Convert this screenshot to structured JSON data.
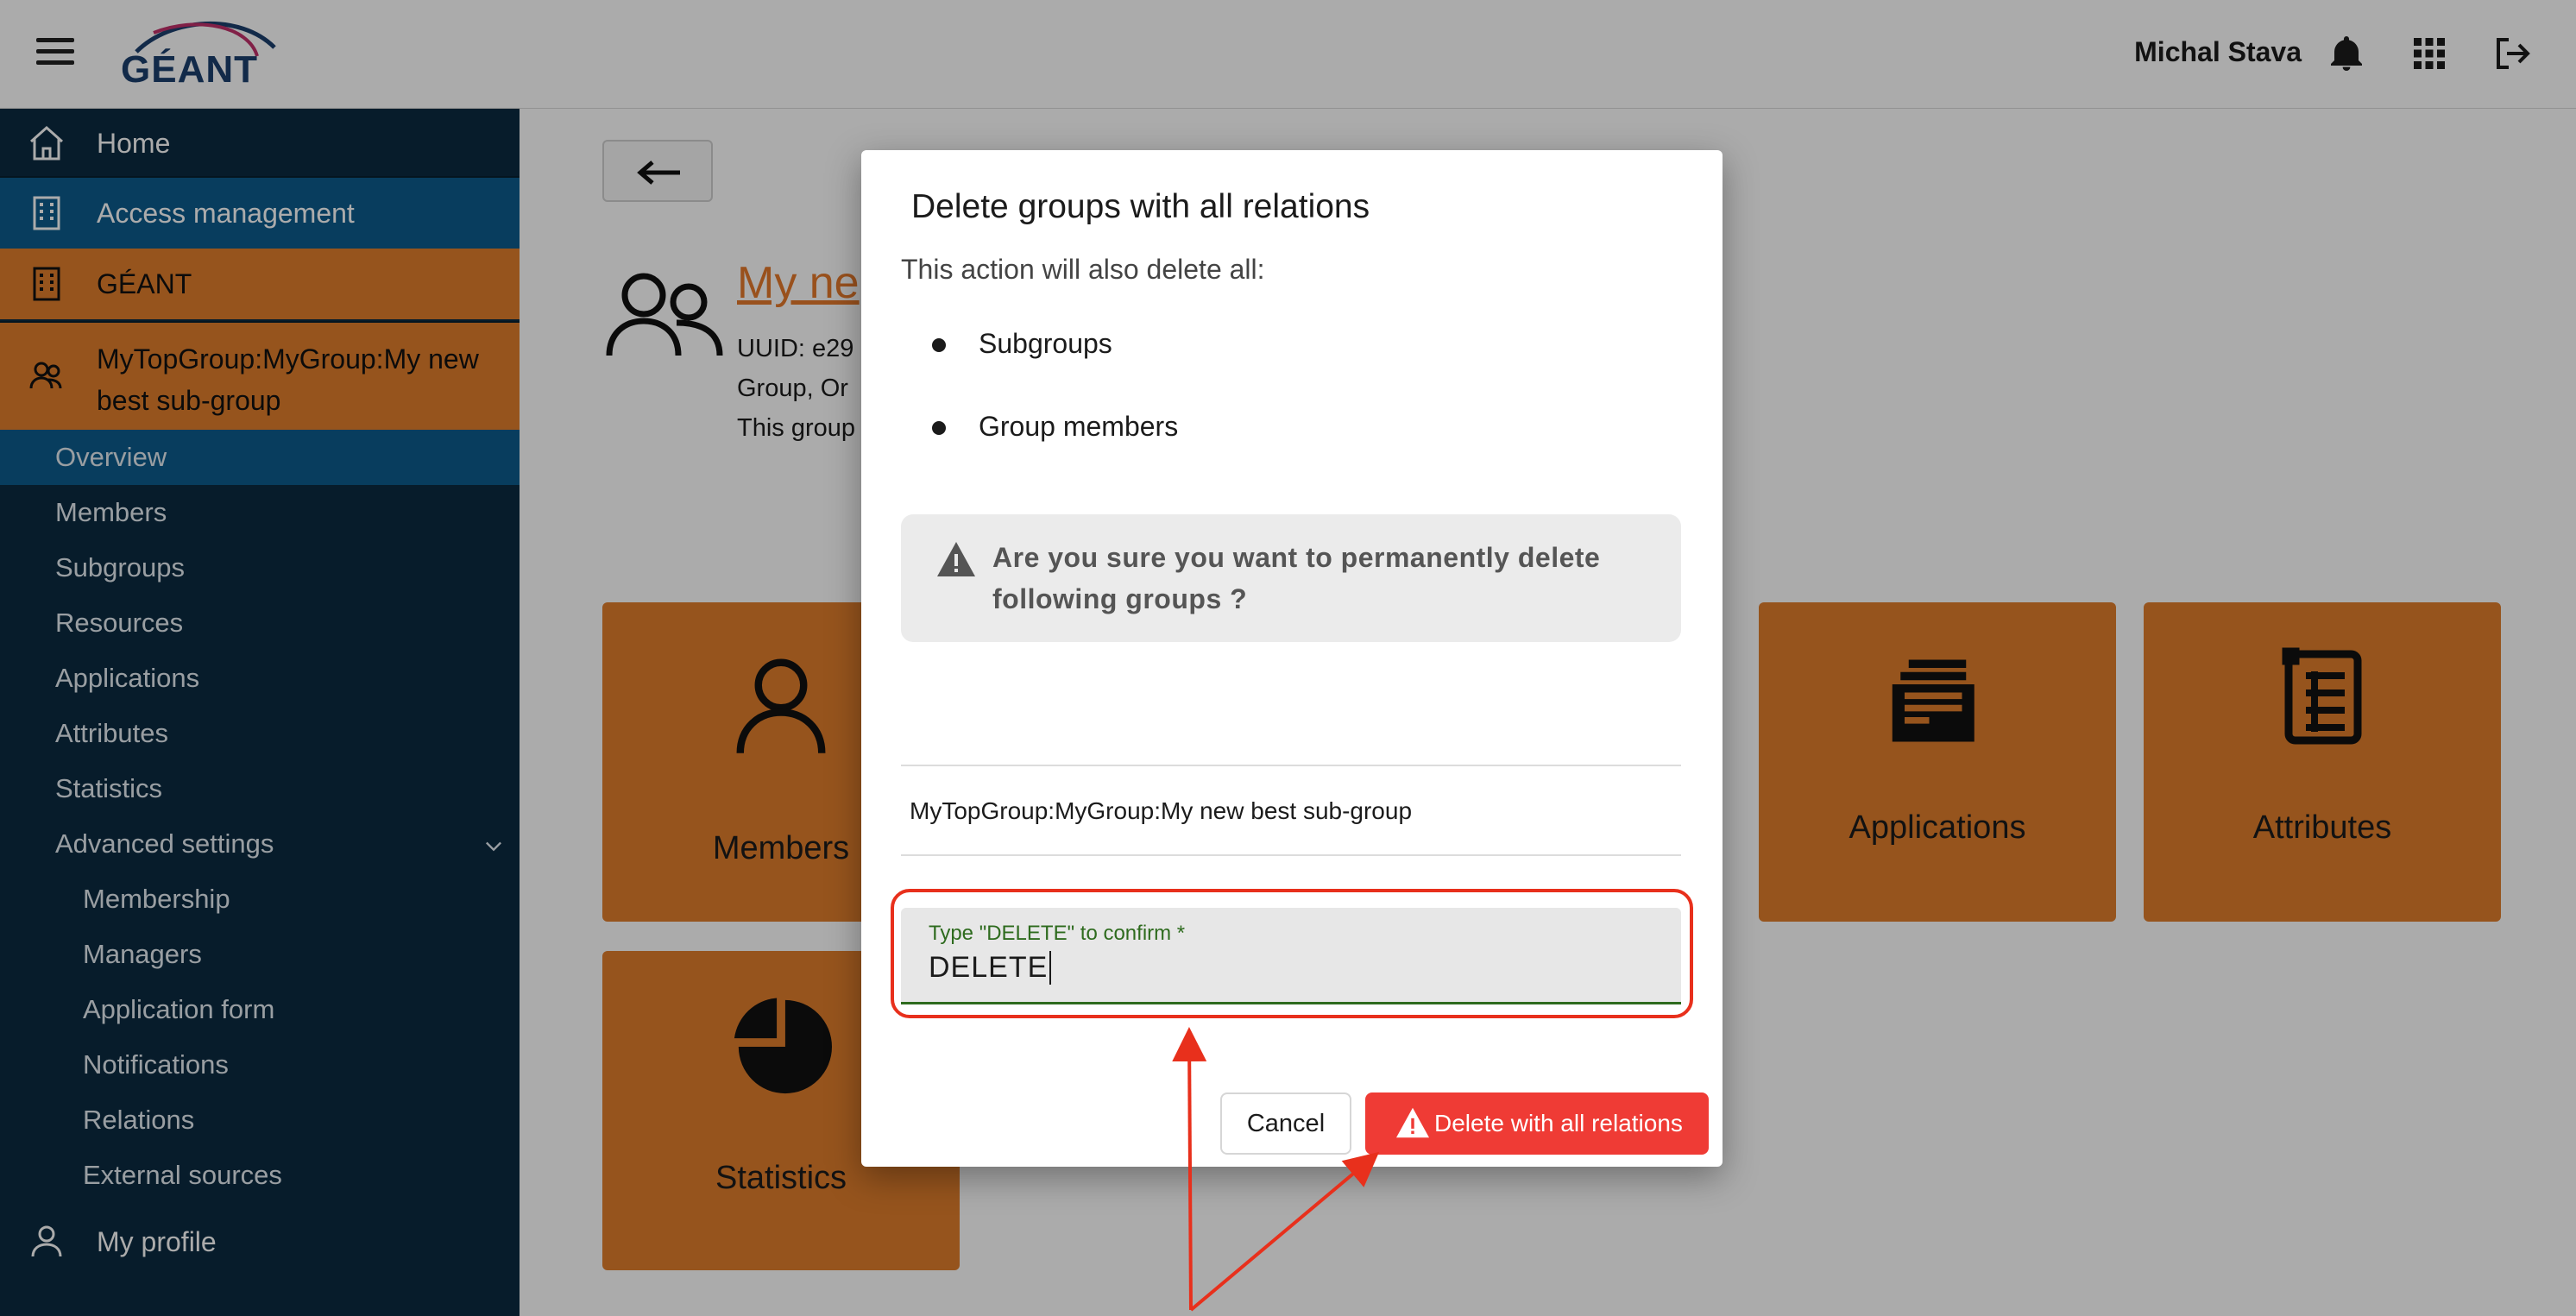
{
  "header": {
    "logo_text": "GÉANT",
    "user_name": "Michal Stava"
  },
  "icons": {
    "menu": "hamburger-menu-icon",
    "notifications": "bell-icon",
    "apps": "grid-apps-icon",
    "logout": "logout-icon",
    "warning": "warning-triangle-icon"
  },
  "sidebar": {
    "items": [
      {
        "label": "Home"
      },
      {
        "label": "Access management"
      },
      {
        "label": "GÉANT"
      },
      {
        "label": "MyTopGroup:MyGroup:My new best sub-group"
      }
    ],
    "group_subitems": [
      "Overview",
      "Members",
      "Subgroups",
      "Resources",
      "Applications",
      "Attributes",
      "Statistics",
      "Advanced settings"
    ],
    "advanced_subitems": [
      "Membership",
      "Managers",
      "Application form",
      "Notifications",
      "Relations",
      "External sources"
    ],
    "profile_label": "My profile",
    "colors": {
      "dark": "#0b2a40",
      "active_blue": "#0d5b8c",
      "orange": "#e07e2c"
    }
  },
  "main": {
    "group_title": "My ne",
    "meta_line1": "UUID: e29",
    "meta_line2": "Group, Or",
    "meta_line3": "This group",
    "tiles": [
      "Members",
      "Applications",
      "Attributes",
      "Statistics"
    ]
  },
  "dialog": {
    "title": "Delete groups with all relations",
    "intro": "This action will also delete all:",
    "bullets": [
      "Subgroups",
      "Group members"
    ],
    "warning_text": "Are you sure you want to permanently delete following groups ?",
    "group_name": "MyTopGroup:MyGroup:My new best sub-group",
    "confirm_label": "Type \"DELETE\" to confirm *",
    "confirm_value": "DELETE",
    "cancel_label": "Cancel",
    "delete_label": "Delete with all relations",
    "colors": {
      "danger": "#ef3b35",
      "highlight": "#e8301c",
      "field_green": "#2e6b1e"
    }
  }
}
